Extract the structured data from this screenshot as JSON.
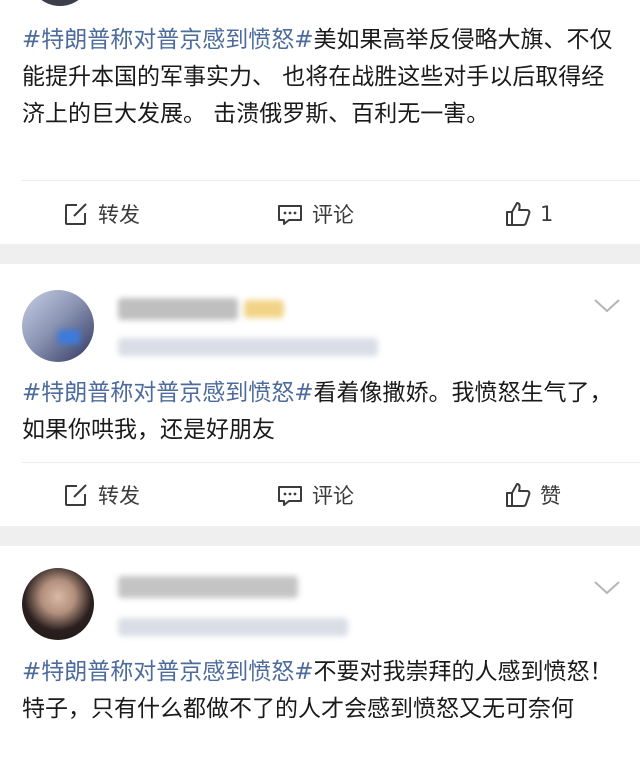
{
  "posts": [
    {
      "hashtag": "#特朗普称对普京感到愤怒#",
      "text": "美如果高举反侵略大旗、不仅能提升本国的军事实力、 也将在战胜这些对手以后取得经济上的巨大发展。 击溃俄罗斯、百利无一害。",
      "forward_label": "转发",
      "comment_label": "评论",
      "like_label": "1"
    },
    {
      "hashtag": "#特朗普称对普京感到愤怒#",
      "text": "看着像撒娇。我愤怒生气了，如果你哄我，还是好朋友",
      "forward_label": "转发",
      "comment_label": "评论",
      "like_label": "赞"
    },
    {
      "hashtag": "#特朗普称对普京感到愤怒#",
      "text": "不要对我崇拜的人感到愤怒！特子，只有什么都做不了的人才会感到愤怒又无可奈何"
    }
  ],
  "icons": {
    "forward": "edit-forward-icon",
    "comment": "comment-bubble-icon",
    "like": "thumbs-up-icon",
    "more": "chevron-down-icon"
  },
  "colors": {
    "hashtag": "#4d6b9c",
    "text": "#1a1a1a",
    "background": "#efefef",
    "card": "#ffffff"
  }
}
